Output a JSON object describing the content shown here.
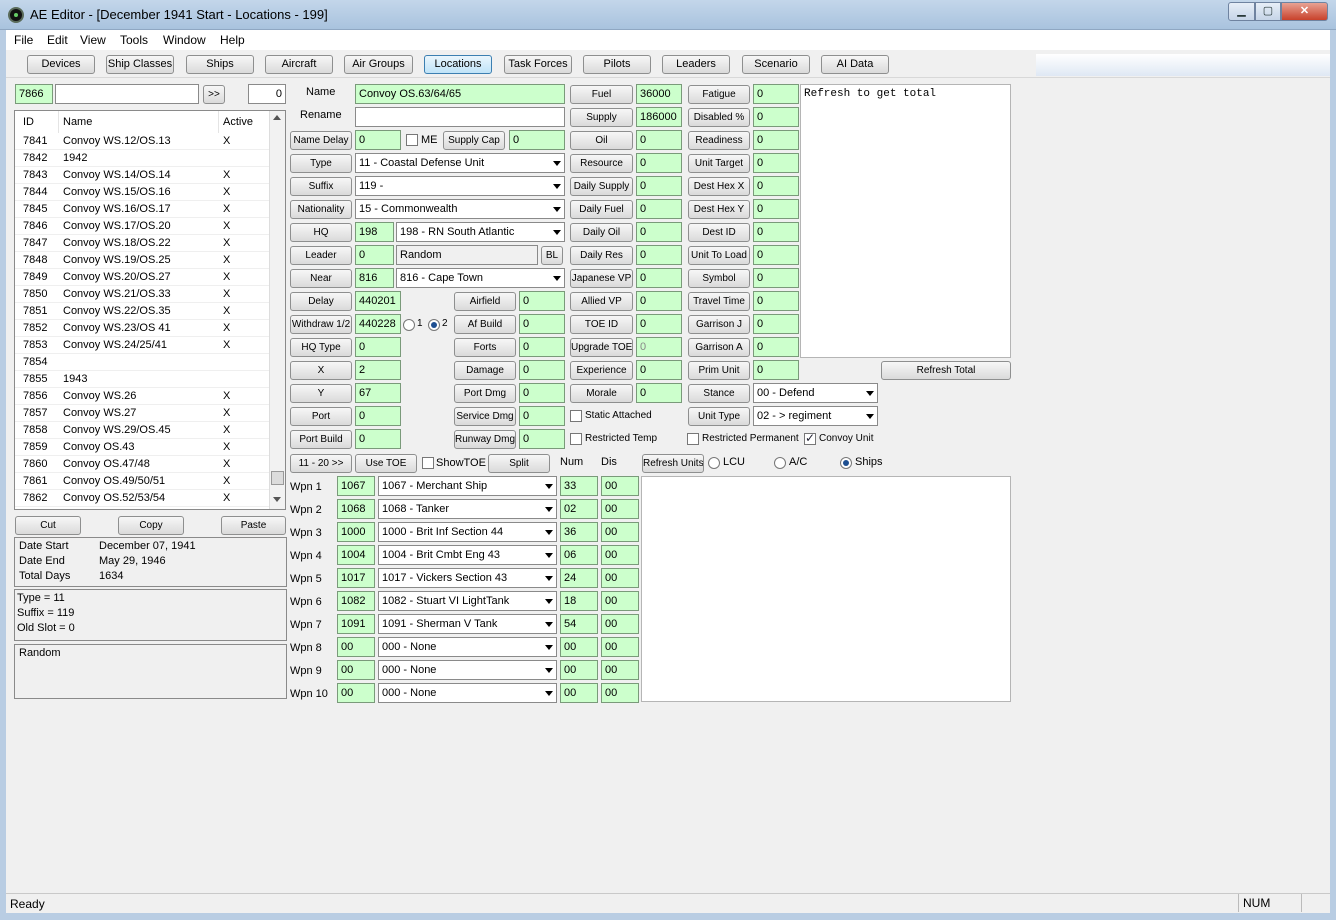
{
  "window": {
    "title": "AE Editor - [December 1941 Start - Locations - 199]",
    "min": "▁",
    "max": "▢",
    "close": "✕"
  },
  "menu": [
    "File",
    "Edit",
    "View",
    "Tools",
    "Window",
    "Help"
  ],
  "tabs": [
    "Devices",
    "Ship Classes",
    "Ships",
    "Aircraft",
    "Air Groups",
    "Locations",
    "Task Forces",
    "Pilots",
    "Leaders",
    "Scenario",
    "AI Data"
  ],
  "active_tab": "Locations",
  "search": {
    "id_value": "7866",
    "text_value": "",
    "go_label": ">>",
    "count": "0"
  },
  "list": {
    "headers": [
      "ID",
      "Name",
      "Active"
    ],
    "rows": [
      {
        "id": "7841",
        "name": "Convoy WS.12/OS.13",
        "active": "X"
      },
      {
        "id": "7842",
        "name": "1942",
        "active": ""
      },
      {
        "id": "7843",
        "name": "Convoy WS.14/OS.14",
        "active": "X"
      },
      {
        "id": "7844",
        "name": "Convoy WS.15/OS.16",
        "active": "X"
      },
      {
        "id": "7845",
        "name": "Convoy WS.16/OS.17",
        "active": "X"
      },
      {
        "id": "7846",
        "name": "Convoy WS.17/OS.20",
        "active": "X"
      },
      {
        "id": "7847",
        "name": "Convoy WS.18/OS.22",
        "active": "X"
      },
      {
        "id": "7848",
        "name": "Convoy WS.19/OS.25",
        "active": "X"
      },
      {
        "id": "7849",
        "name": "Convoy WS.20/OS.27",
        "active": "X"
      },
      {
        "id": "7850",
        "name": "Convoy WS.21/OS.33",
        "active": "X"
      },
      {
        "id": "7851",
        "name": "Convoy WS.22/OS.35",
        "active": "X"
      },
      {
        "id": "7852",
        "name": "Convoy WS.23/OS 41",
        "active": "X"
      },
      {
        "id": "7853",
        "name": "Convoy WS.24/25/41",
        "active": "X"
      },
      {
        "id": "7854",
        "name": "",
        "active": ""
      },
      {
        "id": "7855",
        "name": "1943",
        "active": ""
      },
      {
        "id": "7856",
        "name": "Convoy WS.26",
        "active": "X"
      },
      {
        "id": "7857",
        "name": "Convoy WS.27",
        "active": "X"
      },
      {
        "id": "7858",
        "name": "Convoy WS.29/OS.45",
        "active": "X"
      },
      {
        "id": "7859",
        "name": "Convoy OS.43",
        "active": "X"
      },
      {
        "id": "7860",
        "name": "Convoy OS.47/48",
        "active": "X"
      },
      {
        "id": "7861",
        "name": "Convoy OS.49/50/51",
        "active": "X"
      },
      {
        "id": "7862",
        "name": "Convoy OS.52/53/54",
        "active": "X"
      }
    ]
  },
  "clip": {
    "cut": "Cut",
    "copy": "Copy",
    "paste": "Paste"
  },
  "dates": {
    "start_label": "Date Start",
    "start": "December 07, 1941",
    "end_label": "Date End",
    "end": "May 29, 1946",
    "days_label": "Total Days",
    "days": "1634"
  },
  "info": {
    "type": "Type = 11",
    "suffix": "Suffix = 119",
    "slot": "Old Slot = 0"
  },
  "leader_note": "Random",
  "form": {
    "name_label": "Name",
    "name": "Convoy OS.63/64/65",
    "rename_label": "Rename",
    "rename": "",
    "name_delay_label": "Name Delay",
    "name_delay": "0",
    "me_label": "ME",
    "supply_cap_label": "Supply Cap",
    "supply_cap": "0",
    "type_label": "Type",
    "type": "11 - Coastal Defense Unit",
    "suffix_label": "Suffix",
    "suffix": "119 -",
    "nationality_label": "Nationality",
    "nationality": "15 - Commonwealth",
    "hq_label": "HQ",
    "hq": "198",
    "hq_name": "198 - RN South Atlantic",
    "leader_label": "Leader",
    "leader": "0",
    "leader_name": "Random",
    "bl_label": "BL",
    "near_label": "Near",
    "near": "816",
    "near_name": "816 - Cape Town",
    "delay_label": "Delay",
    "delay": "440201",
    "withdraw_label": "Withdraw 1/2",
    "withdraw": "440228",
    "radio1": "1",
    "radio2": "2",
    "hq_type_label": "HQ Type",
    "hq_type": "0",
    "x_label": "X",
    "x": "2",
    "y_label": "Y",
    "y": "67",
    "port_label": "Port",
    "port": "0",
    "port_build_label": "Port Build",
    "port_build": "0",
    "airfield_label": "Airfield",
    "airfield": "0",
    "af_build_label": "Af Build",
    "af_build": "0",
    "forts_label": "Forts",
    "forts": "0",
    "damage_label": "Damage",
    "damage": "0",
    "port_dmg_label": "Port Dmg",
    "port_dmg": "0",
    "service_dmg_label": "Service Dmg",
    "service_dmg": "0",
    "runway_dmg_label": "Runway Dmg",
    "runway_dmg": "0",
    "fuel_label": "Fuel",
    "fuel": "36000",
    "supply_label": "Supply",
    "supply": "186000",
    "oil_label": "Oil",
    "oil": "0",
    "resource_label": "Resource",
    "resource": "0",
    "daily_supply_label": "Daily Supply",
    "daily_supply": "0",
    "daily_fuel_label": "Daily Fuel",
    "daily_fuel": "0",
    "daily_oil_label": "Daily Oil",
    "daily_oil": "0",
    "daily_res_label": "Daily Res",
    "daily_res": "0",
    "japanese_vp_label": "Japanese VP",
    "japanese_vp": "0",
    "allied_vp_label": "Allied VP",
    "allied_vp": "0",
    "toe_id_label": "TOE ID",
    "toe_id": "0",
    "upgrade_toe_label": "Upgrade TOE",
    "upgrade_toe": "0",
    "experience_label": "Experience",
    "experience": "0",
    "morale_label": "Morale",
    "morale": "0",
    "fatigue_label": "Fatigue",
    "fatigue": "0",
    "disabled_label": "Disabled %",
    "disabled": "0",
    "readiness_label": "Readiness",
    "readiness": "0",
    "unit_target_label": "Unit Target",
    "unit_target": "0",
    "dest_hex_x_label": "Dest Hex X",
    "dest_hex_x": "0",
    "dest_hex_y_label": "Dest Hex Y",
    "dest_hex_y": "0",
    "dest_id_label": "Dest ID",
    "dest_id": "0",
    "unit_to_load_label": "Unit To Load",
    "unit_to_load": "0",
    "symbol_label": "Symbol",
    "symbol": "0",
    "travel_time_label": "Travel Time",
    "travel_time": "0",
    "garrison_j_label": "Garrison J",
    "garrison_j": "0",
    "garrison_a_label": "Garrison A",
    "garrison_a": "0",
    "prim_unit_label": "Prim Unit",
    "prim_unit": "0",
    "stance_label": "Stance",
    "stance": "00 - Defend",
    "unit_type_label": "Unit Type",
    "unit_type": "02 - > regiment",
    "refresh_total_label": "Refresh Total",
    "notes": "Refresh to get total",
    "static_attached_label": "Static Attached",
    "restricted_temp_label": "Restricted Temp",
    "restricted_perm_label": "Restricted Permanent",
    "convoy_unit_label": "Convoy Unit"
  },
  "weapons_bar": {
    "page_label": "11 - 20  >>",
    "use_toe": "Use TOE",
    "show_toe": "ShowTOE",
    "split": "Split",
    "num_label": "Num",
    "dis_label": "Dis",
    "refresh_units": "Refresh Units",
    "lcu": "LCU",
    "ac": "A/C",
    "ships": "Ships"
  },
  "weapons": [
    {
      "label": "Wpn 1",
      "id": "1067",
      "name": "1067 - Merchant Ship",
      "num": "33",
      "dis": "00"
    },
    {
      "label": "Wpn 2",
      "id": "1068",
      "name": "1068 - Tanker",
      "num": "02",
      "dis": "00"
    },
    {
      "label": "Wpn 3",
      "id": "1000",
      "name": "1000 - Brit Inf Section 44",
      "num": "36",
      "dis": "00"
    },
    {
      "label": "Wpn 4",
      "id": "1004",
      "name": "1004 - Brit Cmbt Eng 43",
      "num": "06",
      "dis": "00"
    },
    {
      "label": "Wpn 5",
      "id": "1017",
      "name": "1017 - Vickers Section 43",
      "num": "24",
      "dis": "00"
    },
    {
      "label": "Wpn 6",
      "id": "1082",
      "name": "1082 - Stuart VI LightTank",
      "num": "18",
      "dis": "00"
    },
    {
      "label": "Wpn 7",
      "id": "1091",
      "name": "1091 - Sherman V Tank",
      "num": "54",
      "dis": "00"
    },
    {
      "label": "Wpn 8",
      "id": "00",
      "name": "000 - None",
      "num": "00",
      "dis": "00"
    },
    {
      "label": "Wpn 9",
      "id": "00",
      "name": "000 - None",
      "num": "00",
      "dis": "00"
    },
    {
      "label": "Wpn 10",
      "id": "00",
      "name": "000 - None",
      "num": "00",
      "dis": "00"
    }
  ],
  "status": {
    "text": "Ready",
    "num": "NUM"
  }
}
